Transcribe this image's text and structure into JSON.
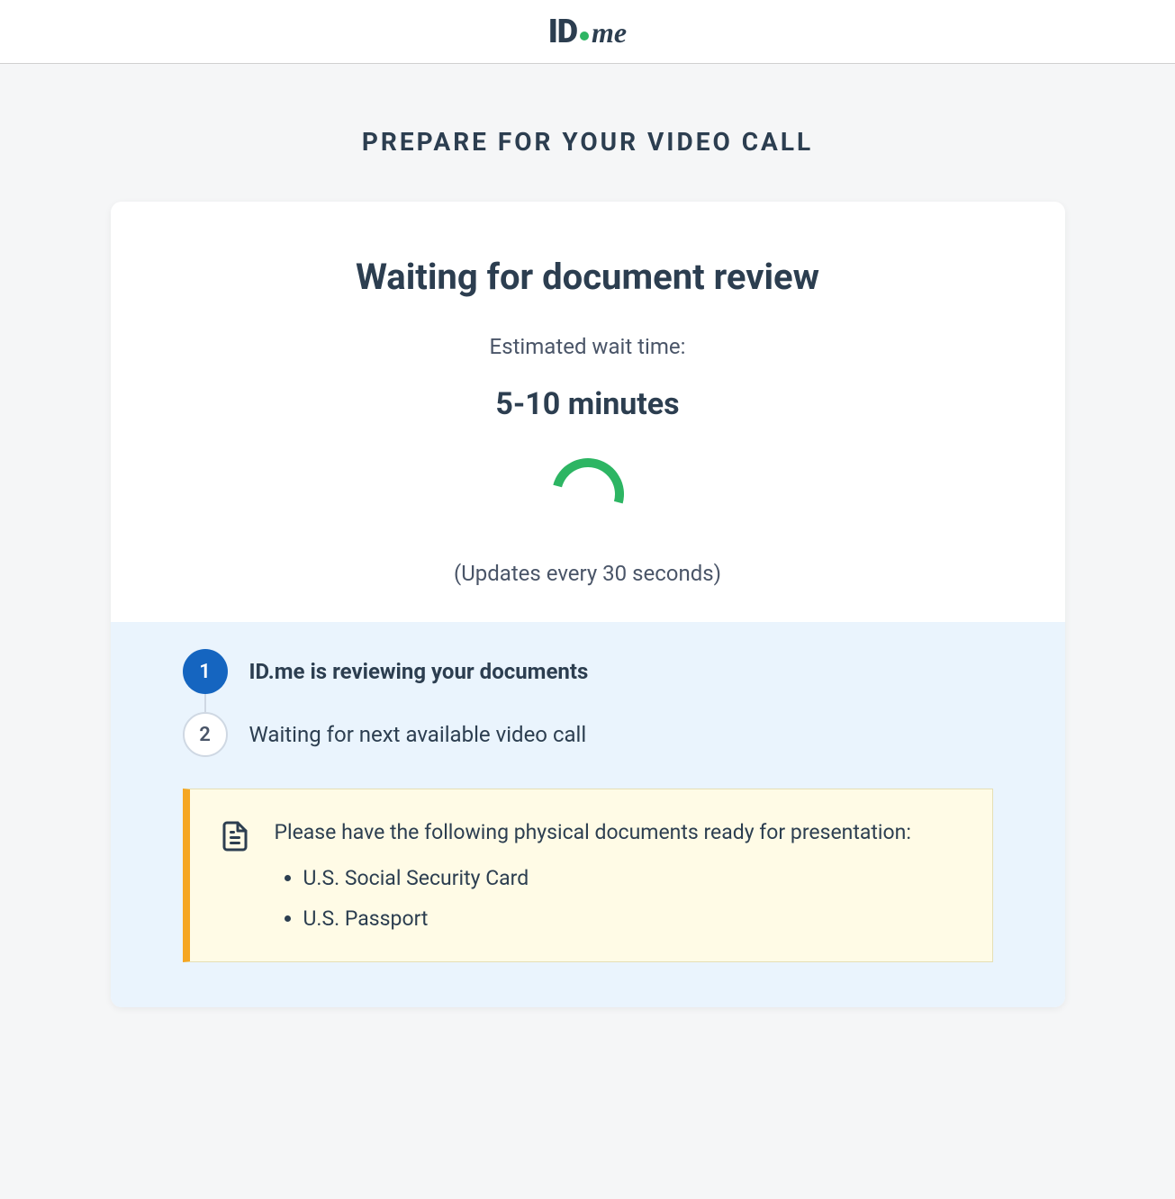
{
  "brand": {
    "id": "ID",
    "me": "me"
  },
  "page": {
    "title": "Prepare for your video call"
  },
  "status": {
    "heading": "Waiting for document review",
    "wait_label": "Estimated wait time:",
    "wait_value": "5-10 minutes",
    "update_note": "(Updates every 30 seconds)"
  },
  "steps": [
    {
      "number": "1",
      "label": "ID.me is reviewing your documents",
      "active": true
    },
    {
      "number": "2",
      "label": "Waiting for next available video call",
      "active": false
    }
  ],
  "notice": {
    "text": "Please have the following physical documents ready for presentation:",
    "documents": [
      "U.S. Social Security Card",
      "U.S. Passport"
    ]
  }
}
